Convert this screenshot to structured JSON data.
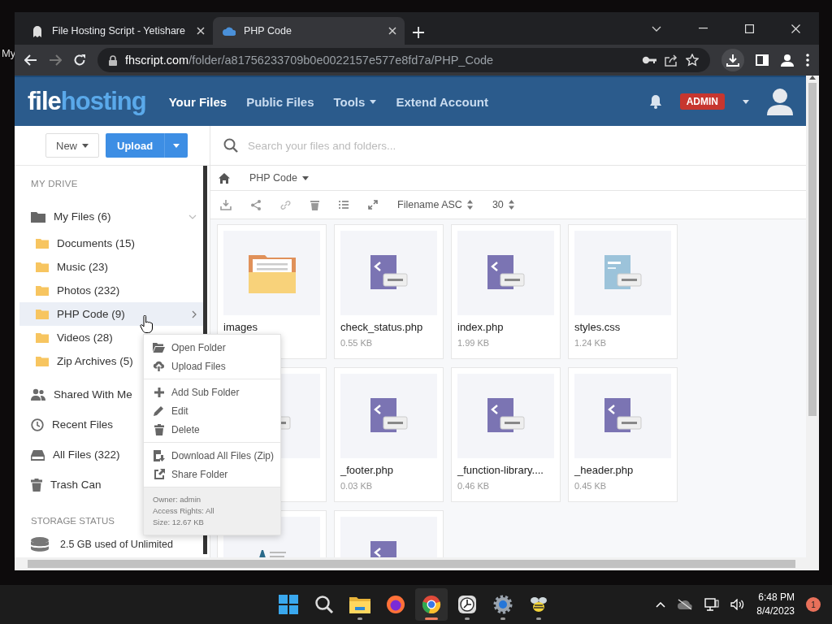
{
  "desktop": {
    "label": "My"
  },
  "browser": {
    "tabs": [
      {
        "title": "File Hosting Script - Yetishare",
        "selected": false
      },
      {
        "title": "PHP Code",
        "selected": true
      }
    ],
    "url": {
      "host": "fhscript.com",
      "path": "/folder/a81756233709b0e0022157e577e8fd7a/PHP_Code"
    }
  },
  "header": {
    "logo": {
      "part_1": "file",
      "part_2": "hosting"
    },
    "nav": [
      {
        "label": "Your Files",
        "selected": true,
        "dropdown": false
      },
      {
        "label": "Public Files",
        "selected": false,
        "dropdown": false
      },
      {
        "label": "Tools",
        "selected": false,
        "dropdown": true
      },
      {
        "label": "Extend Account",
        "selected": false,
        "dropdown": false
      }
    ],
    "badge": "ADMIN"
  },
  "sidebar": {
    "new_button": "New",
    "upload_button": "Upload",
    "section_title": "MY DRIVE",
    "items": [
      {
        "kind": "folder",
        "label": "My Files (6)",
        "expanded": true,
        "children": [
          {
            "label": "Documents (15)",
            "selected": false
          },
          {
            "label": "Music (23)",
            "selected": false
          },
          {
            "label": "Photos (232)",
            "selected": false
          },
          {
            "label": "PHP Code (9)",
            "selected": true
          },
          {
            "label": "Videos (28)",
            "selected": false
          },
          {
            "label": "Zip Archives (5)",
            "selected": false
          }
        ]
      },
      {
        "kind": "shared",
        "label": "Shared With Me"
      },
      {
        "kind": "recent",
        "label": "Recent Files"
      },
      {
        "kind": "all",
        "label": "All Files (322)"
      },
      {
        "kind": "trash",
        "label": "Trash Can"
      }
    ],
    "storage_title": "STORAGE STATUS",
    "storage_text": "2.5 GB used of Unlimited"
  },
  "search": {
    "placeholder": "Search your files and folders..."
  },
  "breadcrumb": {
    "label": "PHP Code"
  },
  "toolbar": {
    "sort": "Filename ASC",
    "per_page": "30"
  },
  "files": [
    {
      "kind": "folder",
      "name": "images"
    },
    {
      "kind": "php",
      "name": "check_status.php",
      "size": "0.55 KB"
    },
    {
      "kind": "php",
      "name": "index.php",
      "size": "1.99 KB"
    },
    {
      "kind": "css",
      "name": "styles.css",
      "size": "1.24 KB"
    },
    {
      "kind": "php"
    },
    {
      "kind": "php",
      "name": "_footer.php",
      "size": "0.03 KB"
    },
    {
      "kind": "php",
      "name": "_function-library....",
      "size": "0.46 KB"
    },
    {
      "kind": "php",
      "name": "_header.php",
      "size": "0.45 KB"
    },
    {
      "kind": "document"
    },
    {
      "kind": "php"
    }
  ],
  "context_menu": {
    "groups": [
      [
        {
          "kind": "open",
          "label": "Open Folder"
        },
        {
          "kind": "upload",
          "label": "Upload Files"
        }
      ],
      [
        {
          "kind": "add",
          "label": "Add Sub Folder"
        },
        {
          "kind": "edit",
          "label": "Edit"
        },
        {
          "kind": "delete",
          "label": "Delete"
        }
      ],
      [
        {
          "kind": "download",
          "label": "Download All Files (Zip)"
        },
        {
          "kind": "share",
          "label": "Share Folder"
        }
      ]
    ],
    "info": [
      "Owner: admin",
      "Access Rights: All",
      "Size: 12.67 KB"
    ]
  },
  "taskbar": {
    "apps": [
      {
        "kind": "start",
        "running": false,
        "selected": false
      },
      {
        "kind": "search",
        "running": false,
        "selected": false
      },
      {
        "kind": "explorer",
        "running": true,
        "selected": false
      },
      {
        "kind": "firefox",
        "running": false,
        "selected": false
      },
      {
        "kind": "chrome",
        "running": true,
        "selected": true
      },
      {
        "kind": "clock",
        "running": true,
        "selected": false
      },
      {
        "kind": "settings",
        "running": true,
        "selected": false
      },
      {
        "kind": "bee",
        "running": true,
        "selected": false
      }
    ],
    "time": "6:48 PM",
    "date": "8/4/2023",
    "notification_count": "1"
  }
}
